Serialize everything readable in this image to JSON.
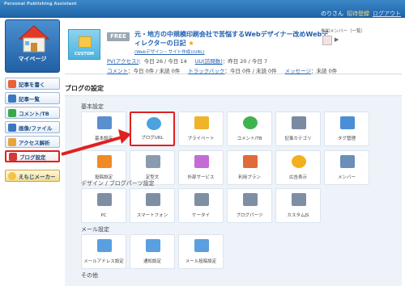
{
  "topbar": {
    "brand": "Personal Publishing Assistant",
    "greeting": "のりさん",
    "register_link": "招待登録",
    "logout_link": "ログアウト"
  },
  "sidebar": {
    "mypage_label": "マイページ",
    "items": [
      {
        "label": "記事を書く",
        "icon": "pencil-icon",
        "color": "#e8623a"
      },
      {
        "label": "記事一覧",
        "icon": "list-icon",
        "color": "#3a78c2"
      },
      {
        "label": "コメント/TB",
        "icon": "comment-icon",
        "color": "#38a84a"
      },
      {
        "label": "画像/ファイル",
        "icon": "image-icon",
        "color": "#3a78c2"
      },
      {
        "label": "アクセス解析",
        "icon": "chart-icon",
        "color": "#e8a33a"
      },
      {
        "label": "ブログ設定",
        "icon": "wrench-icon",
        "color": "#d23a3a",
        "active": true
      }
    ],
    "emoji_label": "えもじメーカー"
  },
  "header": {
    "custom_label": "CUSTOM",
    "free_tag": "FREE",
    "blog_title": "元・地方の中規模印刷会社で苦悩するWebデザイナー改めWebディレクターの日記",
    "blog_star": "★",
    "blog_subtitle": "(Webデザイン・サイト作成)(URL)",
    "members_label": "参加メンバー（一覧）",
    "members_arrow": "▶",
    "stats": {
      "pv_label": "PV(アクセス)",
      "pv_today": "：今日 26",
      "pv_yesterday": "/ 今日 14",
      "uu_label": "UU(訪問数)",
      "uu_value": "：昨日 20 / 今日 7",
      "comment_label": "コメント",
      "comment_value": "：今日 0件 / 未読 0件",
      "trackback_label": "トラックバック",
      "trackback_value": "：今日 0件 / 未読 0件",
      "message_label": "メッセージ",
      "message_value": "：未読 0件"
    }
  },
  "main": {
    "section_title": "ブログの設定",
    "groups": [
      {
        "label": "基本設定",
        "tiles": [
          {
            "label": "基本設定",
            "icon": "home-icon",
            "color": "#5a8fcf"
          },
          {
            "label": "ブログURL",
            "icon": "www-globe-icon",
            "color": "#4aa3df",
            "highlight": true
          },
          {
            "label": "プライベート",
            "icon": "lock-icon",
            "color": "#f0b429"
          },
          {
            "label": "コメント/TB",
            "icon": "speech-bubble-icon",
            "color": "#3fb34f"
          },
          {
            "label": "記事カテゴリ",
            "icon": "folder-icon",
            "color": "#7a8aa0"
          },
          {
            "label": "タグ管理",
            "icon": "tag-icon",
            "color": "#4a8fd6"
          },
          {
            "label": "投稿設定",
            "icon": "pencil-icon",
            "color": "#f08a24"
          },
          {
            "label": "定型文",
            "icon": "document-icon",
            "color": "#8a9bb0"
          },
          {
            "label": "外部サービス",
            "icon": "puzzle-icon",
            "color": "#c46bd6"
          },
          {
            "label": "利用プラン",
            "icon": "calendar-icon",
            "color": "#e06a3a"
          },
          {
            "label": "広告表示",
            "icon": "coin-icon",
            "color": "#f2b01e"
          },
          {
            "label": "メンバー",
            "icon": "users-icon",
            "color": "#6a8fb8"
          }
        ]
      },
      {
        "label": "デザイン / ブログパーツ設定",
        "tiles": [
          {
            "label": "PC",
            "icon": "monitor-icon",
            "color": "#7f8fa3"
          },
          {
            "label": "スマートフォン",
            "icon": "smartphone-icon",
            "color": "#7f8fa3"
          },
          {
            "label": "ケータイ",
            "icon": "mobile-phone-icon",
            "color": "#7f8fa3"
          },
          {
            "label": "ブログパーツ",
            "icon": "grid-blocks-icon",
            "color": "#7f8fa3"
          },
          {
            "label": "カスタムJS",
            "icon": "js-file-icon",
            "color": "#7f8fa3"
          }
        ]
      },
      {
        "label": "メール設定",
        "tiles": [
          {
            "label": "メールアドレス設定",
            "icon": "envelope-icon",
            "color": "#5a9fdf"
          },
          {
            "label": "通知設定",
            "icon": "notify-envelope-icon",
            "color": "#5a9fdf"
          },
          {
            "label": "メール投稿設定",
            "icon": "mail-phone-icon",
            "color": "#5a9fdf"
          }
        ]
      },
      {
        "label": "その他",
        "tiles": []
      }
    ]
  }
}
